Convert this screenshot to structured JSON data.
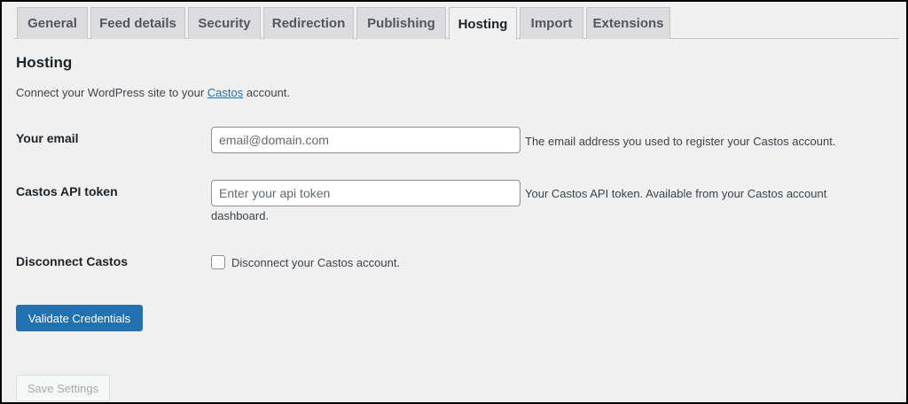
{
  "tabs": [
    {
      "label": "General"
    },
    {
      "label": "Feed details"
    },
    {
      "label": "Security"
    },
    {
      "label": "Redirection"
    },
    {
      "label": "Publishing"
    },
    {
      "label": "Hosting",
      "active": true
    },
    {
      "label": "Import"
    },
    {
      "label": "Extensions"
    }
  ],
  "section": {
    "title": "Hosting",
    "intro_before": "Connect your WordPress site to your ",
    "intro_link": "Castos",
    "intro_after": " account."
  },
  "fields": {
    "email": {
      "label": "Your email",
      "placeholder": "email@domain.com",
      "value": "",
      "description": "The email address you used to register your Castos account."
    },
    "api_token": {
      "label": "Castos API token",
      "placeholder": "Enter your api token",
      "value": "",
      "description_line1": "Your Castos API token. Available from your Castos account",
      "description_line2": "dashboard."
    },
    "disconnect": {
      "label": "Disconnect Castos",
      "checkbox_label": "Disconnect your Castos account.",
      "checked": false
    }
  },
  "buttons": {
    "validate": "Validate Credentials",
    "save": "Save Settings"
  },
  "colors": {
    "primary": "#2271b1",
    "background": "#f0f0f1",
    "tab_inactive": "#dcdcde"
  }
}
